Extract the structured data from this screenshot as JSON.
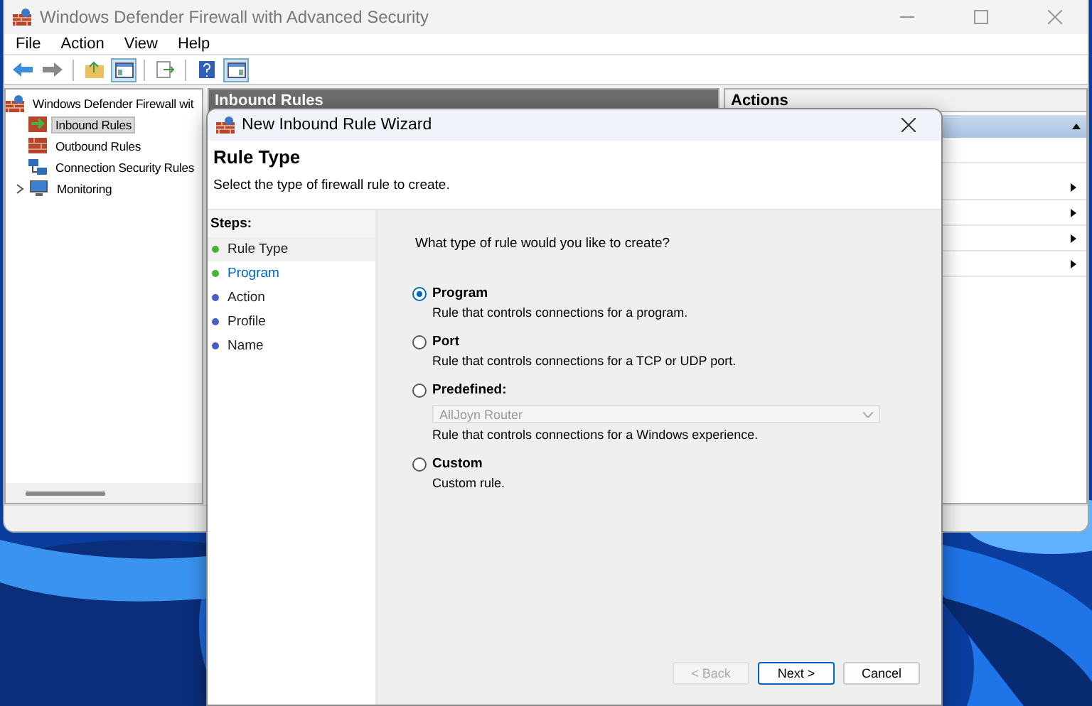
{
  "window": {
    "title": "Windows Defender Firewall with Advanced Security",
    "menu": [
      "File",
      "Action",
      "View",
      "Help"
    ]
  },
  "tree": [
    {
      "label": "Windows Defender Firewall wit",
      "kind": "root",
      "children": [
        {
          "label": "Inbound Rules",
          "kind": "inbound",
          "selected": true
        },
        {
          "label": "Outbound Rules",
          "kind": "outbound",
          "selected": false
        },
        {
          "label": "Connection Security Rules",
          "kind": "connection",
          "selected": false
        },
        {
          "label": "Monitoring",
          "kind": "monitoring",
          "selected": false,
          "expanded": false
        }
      ]
    }
  ],
  "middle_pane": {
    "title": "Inbound Rules"
  },
  "actions_pane": {
    "title": "Actions"
  },
  "dialog": {
    "title": "New Inbound Rule Wizard",
    "heading": "Rule Type",
    "subheading": "Select the type of firewall rule to create.",
    "steps_label": "Steps:",
    "steps": [
      {
        "label": "Rule Type",
        "selected": true,
        "link": false,
        "color": "#4caf3c"
      },
      {
        "label": "Program",
        "selected": false,
        "link": true,
        "color": "#4caf3c"
      },
      {
        "label": "Action",
        "selected": false,
        "link": false,
        "color": "#4a5cc8"
      },
      {
        "label": "Profile",
        "selected": false,
        "link": false,
        "color": "#4a5cc8"
      },
      {
        "label": "Name",
        "selected": false,
        "link": false,
        "color": "#4a5cc8"
      }
    ],
    "question": "What type of rule would you like to create?",
    "options": [
      {
        "label": "Program",
        "description": "Rule that controls connections for a program.",
        "selected": true
      },
      {
        "label": "Port",
        "description": "Rule that controls connections for a TCP or UDP port.",
        "selected": false
      },
      {
        "label": "Predefined:",
        "description": "Rule that controls connections for a Windows experience.",
        "selected": false,
        "dropdown": {
          "value": "AllJoyn Router",
          "disabled": true
        }
      },
      {
        "label": "Custom",
        "description": "Custom rule.",
        "selected": false
      }
    ],
    "buttons": [
      {
        "label": "< Back",
        "disabled": true,
        "default": false
      },
      {
        "label": "Next >",
        "disabled": false,
        "default": true
      },
      {
        "label": "Cancel",
        "disabled": false,
        "default": false
      }
    ]
  }
}
